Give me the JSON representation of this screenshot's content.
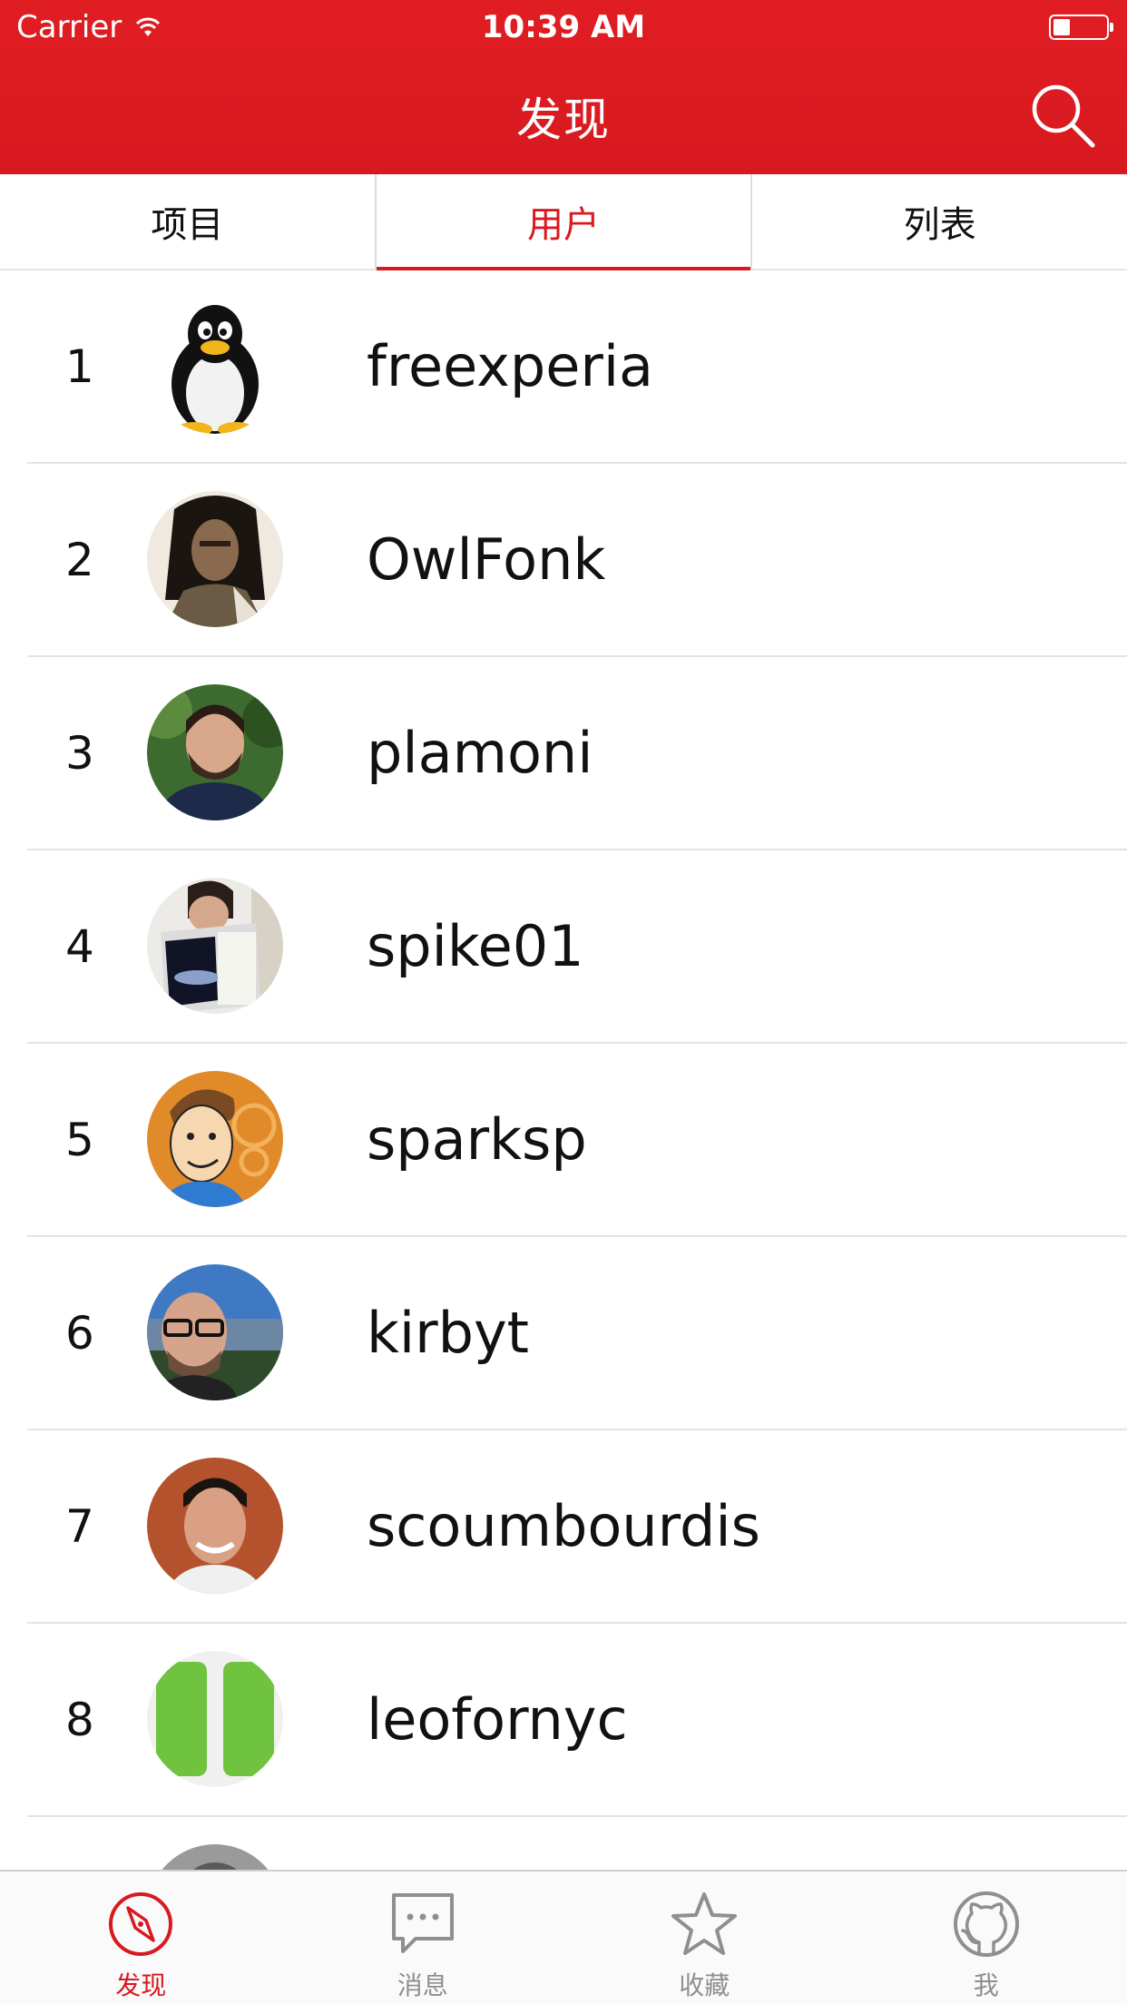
{
  "status_bar": {
    "carrier": "Carrier",
    "time": "10:39 AM"
  },
  "header": {
    "title": "发现",
    "search_icon": "search-icon"
  },
  "tabs": [
    {
      "label": "项目",
      "active": false
    },
    {
      "label": "用户",
      "active": true
    },
    {
      "label": "列表",
      "active": false
    }
  ],
  "users": [
    {
      "rank": "1",
      "name": "freexperia",
      "avatar": "penguin"
    },
    {
      "rank": "2",
      "name": "OwlFonk",
      "avatar": "warrior"
    },
    {
      "rank": "3",
      "name": "plamoni",
      "avatar": "man-beard"
    },
    {
      "rank": "4",
      "name": "spike01",
      "avatar": "reading-book"
    },
    {
      "rank": "5",
      "name": "sparksp",
      "avatar": "cartoon"
    },
    {
      "rank": "6",
      "name": "kirbyt",
      "avatar": "man-glasses"
    },
    {
      "rank": "7",
      "name": "scoumbourdis",
      "avatar": "man-smile"
    },
    {
      "rank": "8",
      "name": "leofornyc",
      "avatar": "green-identicon"
    },
    {
      "rank": "",
      "name": "",
      "avatar": "partial"
    }
  ],
  "tab_bar": [
    {
      "label": "发现",
      "icon": "compass-icon",
      "active": true
    },
    {
      "label": "消息",
      "icon": "message-icon",
      "active": false
    },
    {
      "label": "收藏",
      "icon": "star-icon",
      "active": false
    },
    {
      "label": "我",
      "icon": "github-icon",
      "active": false
    }
  ],
  "colors": {
    "accent": "#d71a20",
    "header_bg": "#e01d22",
    "tab_inactive": "#8e8e93",
    "divider": "#e3e3e3"
  }
}
